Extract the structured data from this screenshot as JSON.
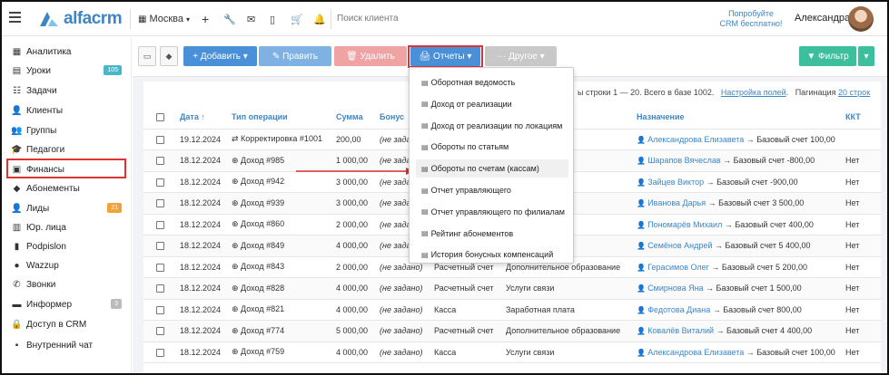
{
  "topbar": {
    "logo_text": "alfacrm",
    "branch": "Москва",
    "search_placeholder": "Поиск клиента",
    "promo_line1": "Попробуйте",
    "promo_line2": "CRM бесплатно!",
    "user_name": "Александра"
  },
  "sidebar": {
    "items": [
      {
        "label": "Аналитика",
        "icon": "chart-icon",
        "glyph": "▦"
      },
      {
        "label": "Уроки",
        "icon": "calendar-icon",
        "glyph": "▤",
        "badge": "105",
        "badge_color": "#4ab6c8"
      },
      {
        "label": "Задачи",
        "icon": "tasks-icon",
        "glyph": "☷"
      },
      {
        "label": "Клиенты",
        "icon": "user-icon",
        "glyph": "👤"
      },
      {
        "label": "Группы",
        "icon": "users-icon",
        "glyph": "👥"
      },
      {
        "label": "Педагоги",
        "icon": "teacher-icon",
        "glyph": "🎓"
      },
      {
        "label": "Финансы",
        "icon": "money-icon",
        "glyph": "▣"
      },
      {
        "label": "Абонементы",
        "icon": "tag-icon",
        "glyph": "◆"
      },
      {
        "label": "Лиды",
        "icon": "add-user-icon",
        "glyph": "👤",
        "badge": "21",
        "badge_color": "#f0a33a"
      },
      {
        "label": "Юр. лица",
        "icon": "building-icon",
        "glyph": "▥"
      },
      {
        "label": "Podpislon",
        "icon": "document-icon",
        "glyph": "▮"
      },
      {
        "label": "Wazzup",
        "icon": "whatsapp-icon",
        "glyph": "●"
      },
      {
        "label": "Звонки",
        "icon": "phone-icon",
        "glyph": "✆"
      },
      {
        "label": "Информер",
        "icon": "briefcase-icon",
        "glyph": "▬",
        "badge": "3",
        "badge_color": "#bbbbbb"
      },
      {
        "label": "Доступ в CRM",
        "icon": "lock-icon",
        "glyph": "🔒"
      },
      {
        "label": "Внутренний чат",
        "icon": "chat-icon",
        "glyph": "▪"
      }
    ]
  },
  "toolbar": {
    "add_label": "+ Добавить ▾",
    "edit_label": "✎ Править",
    "delete_label": "🗑 Удалить",
    "reports_label": "🖨 Отчеты ▾",
    "other_label": "··· Другое ▾",
    "filter_label": "▼ Фильтр",
    "colors": {
      "blue": "#4a90d9",
      "blue_light": "#7fb1e3",
      "red_light": "#f0a3a3",
      "gray": "#c8c8c8",
      "green": "#3dbf9e"
    }
  },
  "info": {
    "rows_text": "ы строки 1 — 20. Всего в базе 1002.",
    "settings_link": "Настройка полей",
    "pagination_label": "Пагинация",
    "pagination_link": "20 строк"
  },
  "dropdown": {
    "items": [
      "Оборотная ведомость",
      "Доход от реализации",
      "Доход от реализации по локациям",
      "Обороты по статьям",
      "Обороты по счетам (кассам)",
      "Отчет управляющего",
      "Отчет управляющего по филиалам",
      "Рейтинг абонементов",
      "История бонусных компенсаций"
    ]
  },
  "table": {
    "headers": [
      "Дата ↑",
      "Тип операции",
      "Сумма",
      "Бонус",
      "",
      "",
      "Назначение",
      "ККТ"
    ],
    "rows": [
      {
        "date": "19.12.2024",
        "op": "⇄ Корректировка #1001",
        "sum": "200,00",
        "bonus": "(не задан",
        "c5": "",
        "c6": "",
        "dest_name": "Александрова Елизавета",
        "dest_rest": " → Базовый счет 100,00",
        "kkt": ""
      },
      {
        "date": "18.12.2024",
        "op": "⊕ Доход #985",
        "sum": "1 000,00",
        "bonus": "(не задан",
        "c5": "",
        "c6": "",
        "dest_name": "Шарапов Вячеслав",
        "dest_rest": " → Базовый счет -800,00",
        "kkt": "Нет"
      },
      {
        "date": "18.12.2024",
        "op": "⊕ Доход #942",
        "sum": "3 000,00",
        "bonus": "(не задан",
        "c5": "",
        "c6": "образование",
        "dest_name": "Зайцев Виктор",
        "dest_rest": " → Базовый счет -900,00",
        "kkt": "Нет"
      },
      {
        "date": "18.12.2024",
        "op": "⊕ Доход #939",
        "sum": "3 000,00",
        "bonus": "(не задан",
        "c5": "",
        "c6": "",
        "dest_name": "Иванова Дарья",
        "dest_rest": " → Базовый счет 3 500,00",
        "kkt": "Нет"
      },
      {
        "date": "18.12.2024",
        "op": "⊕ Доход #860",
        "sum": "2 000,00",
        "bonus": "(не задан",
        "c5": "",
        "c6": "образование",
        "dest_name": "Пономарёв Михаил",
        "dest_rest": " → Базовый счет 400,00",
        "kkt": "Нет"
      },
      {
        "date": "18.12.2024",
        "op": "⊕ Доход #849",
        "sum": "4 000,00",
        "bonus": "(не задан",
        "c5": "",
        "c6": "и",
        "dest_name": "Семёнов Андрей",
        "dest_rest": " → Базовый счет 5 400,00",
        "kkt": "Нет"
      },
      {
        "date": "18.12.2024",
        "op": "⊕ Доход #843",
        "sum": "2 000,00",
        "bonus": "(не задано)",
        "c5": "Расчетный счет",
        "c6": "Дополнительное образование",
        "dest_name": "Герасимов Олег",
        "dest_rest": " → Базовый счет 5 200,00",
        "kkt": "Нет"
      },
      {
        "date": "18.12.2024",
        "op": "⊕ Доход #828",
        "sum": "4 000,00",
        "bonus": "(не задано)",
        "c5": "Расчетный счет",
        "c6": "Услуги связи",
        "dest_name": "Смирнова Яна",
        "dest_rest": " → Базовый счет 1 500,00",
        "kkt": "Нет"
      },
      {
        "date": "18.12.2024",
        "op": "⊕ Доход #821",
        "sum": "4 000,00",
        "bonus": "(не задано)",
        "c5": "Касса",
        "c6": "Заработная плата",
        "dest_name": "Федотова Диана",
        "dest_rest": " → Базовый счет 800,00",
        "kkt": "Нет"
      },
      {
        "date": "18.12.2024",
        "op": "⊕ Доход #774",
        "sum": "5 000,00",
        "bonus": "(не задано)",
        "c5": "Расчетный счет",
        "c6": "Дополнительное образование",
        "dest_name": "Ковалёв Виталий",
        "dest_rest": " → Базовый счет 4 400,00",
        "kkt": "Нет"
      },
      {
        "date": "18.12.2024",
        "op": "⊕ Доход #759",
        "sum": "4 000,00",
        "bonus": "(не задано)",
        "c5": "Касса",
        "c6": "Услуги связи",
        "dest_name": "Александрова Елизавета",
        "dest_rest": " → Базовый счет 100,00",
        "kkt": "Нет"
      }
    ]
  }
}
